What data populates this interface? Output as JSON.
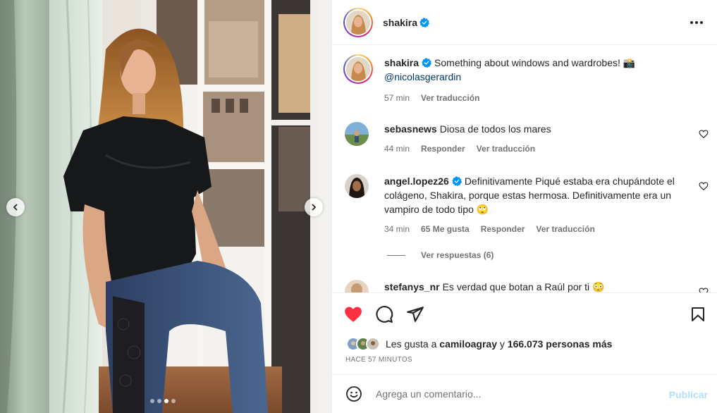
{
  "post": {
    "username": "shakira",
    "caption_text": "Something about windows and wardrobes! 📸",
    "caption_mention": "@nicolasgerardin",
    "caption_time": "57 min",
    "caption_translate": "Ver traducción"
  },
  "comments": [
    {
      "username": "sebasnews",
      "text": "Diosa de todos los mares",
      "time": "44 min",
      "reply": "Responder",
      "translate": "Ver traducción"
    },
    {
      "username": "angel.lopez26",
      "text": "Definitivamente Piqué estaba era chupándote el colágeno, Shakira, porque estas hermosa. Definitivamente era un vampiro de todo tipo 🙄",
      "time": "34 min",
      "likes": "65 Me gusta",
      "reply": "Responder",
      "translate": "Ver traducción",
      "view_replies": "Ver respuestas (6)"
    },
    {
      "username": "stefanys_nr",
      "text": "Es verdad que botan a Raúl por ti 😳"
    }
  ],
  "likes": {
    "prefix": "Les gusta a",
    "user": "camiloagray",
    "joiner": "y",
    "others": "166.073 personas más"
  },
  "timestamp": "HACE 57 MINUTOS",
  "add_comment": {
    "placeholder": "Agrega un comentario...",
    "publish": "Publicar"
  },
  "carousel": {
    "total": 4,
    "active": 2
  },
  "icons": {
    "like": "heart-filled-icon",
    "comment": "comment-bubble-icon",
    "share": "paper-plane-icon",
    "save": "bookmark-icon",
    "more": "more-horizontal-icon",
    "emoji": "emoji-smile-icon",
    "verified": "verified-badge-icon"
  },
  "colors": {
    "like_red": "#ff3040",
    "verified_blue": "#0095f6",
    "publish_disabled": "#b2dffc",
    "mention": "#00376b",
    "secondary_text": "#737373"
  }
}
